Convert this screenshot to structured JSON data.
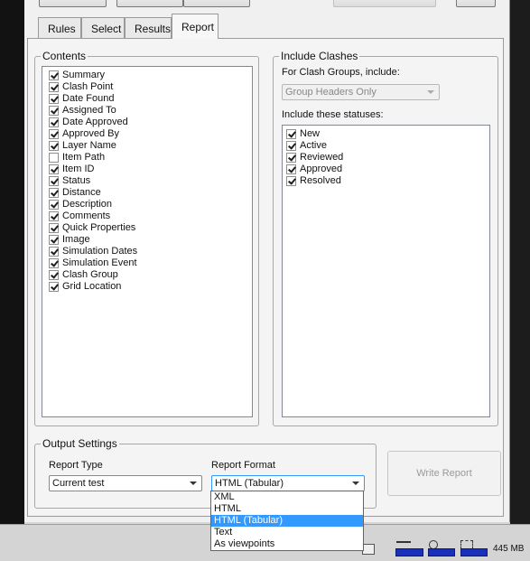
{
  "tabs": [
    {
      "label": "Rules"
    },
    {
      "label": "Select"
    },
    {
      "label": "Results"
    },
    {
      "label": "Report"
    }
  ],
  "active_tab": "Report",
  "contents": {
    "title": "Contents",
    "items": [
      {
        "label": "Summary",
        "checked": true
      },
      {
        "label": "Clash Point",
        "checked": true
      },
      {
        "label": "Date Found",
        "checked": true
      },
      {
        "label": "Assigned To",
        "checked": true
      },
      {
        "label": "Date Approved",
        "checked": true
      },
      {
        "label": "Approved By",
        "checked": true
      },
      {
        "label": "Layer Name",
        "checked": true
      },
      {
        "label": "Item Path",
        "checked": false
      },
      {
        "label": "Item ID",
        "checked": true
      },
      {
        "label": "Status",
        "checked": true
      },
      {
        "label": "Distance",
        "checked": true
      },
      {
        "label": "Description",
        "checked": true
      },
      {
        "label": "Comments",
        "checked": true
      },
      {
        "label": "Quick Properties",
        "checked": true
      },
      {
        "label": "Image",
        "checked": true
      },
      {
        "label": "Simulation Dates",
        "checked": true
      },
      {
        "label": "Simulation Event",
        "checked": true
      },
      {
        "label": "Clash Group",
        "checked": true
      },
      {
        "label": "Grid Location",
        "checked": true
      }
    ]
  },
  "include_clashes": {
    "title": "Include Clashes",
    "groups_label": "For Clash Groups, include:",
    "groups_value": "Group Headers Only",
    "statuses_label": "Include these statuses:",
    "statuses": [
      {
        "label": "New",
        "checked": true
      },
      {
        "label": "Active",
        "checked": true
      },
      {
        "label": "Reviewed",
        "checked": true
      },
      {
        "label": "Approved",
        "checked": true
      },
      {
        "label": "Resolved",
        "checked": true
      }
    ]
  },
  "output": {
    "title": "Output Settings",
    "report_type_label": "Report Type",
    "report_type_value": "Current test",
    "report_format_label": "Report Format",
    "report_format_value": "HTML (Tabular)",
    "format_options": [
      "XML",
      "HTML",
      "HTML (Tabular)",
      "Text",
      "As viewpoints"
    ],
    "selected_format_index": 2,
    "write_button": "Write Report"
  },
  "status": {
    "memory": "445 MB",
    "accent": "#1a30b8"
  }
}
